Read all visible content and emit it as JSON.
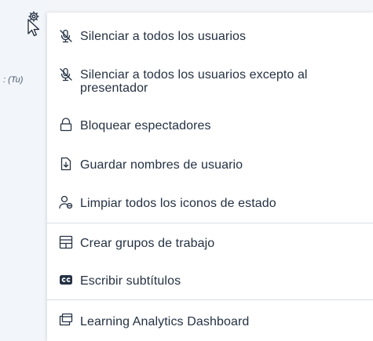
{
  "participant": {
    "you_label": ": (Tu)"
  },
  "menu": {
    "items": [
      {
        "label": "Silenciar a todos los usuarios",
        "icon": "mute-icon"
      },
      {
        "label": "Silenciar a todos los usuarios excepto al",
        "label2": "presentador",
        "icon": "mute-icon"
      },
      {
        "label": "Bloquear espectadores",
        "icon": "lock-icon"
      },
      {
        "label": "Guardar nombres de usuario",
        "icon": "download-file-icon"
      },
      {
        "label": "Limpiar todos los iconos de estado",
        "icon": "clear-status-icon"
      },
      {
        "label": "Crear grupos de trabajo",
        "icon": "rooms-icon"
      },
      {
        "label": "Escribir subtítulos",
        "icon": "closed-captions-icon"
      },
      {
        "label": "Learning Analytics Dashboard",
        "icon": "dashboard-icon"
      }
    ]
  }
}
